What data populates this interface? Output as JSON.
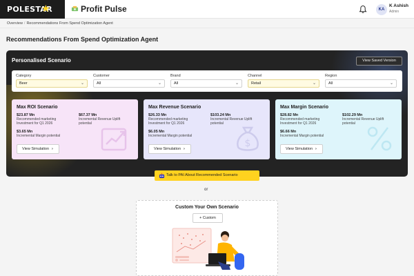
{
  "header": {
    "brand": "POLESTAR",
    "product": "Profit Pulse",
    "user": {
      "initials": "KA",
      "name": "K Ashish",
      "role": "Admin"
    },
    "icons": [
      "bell-icon",
      "star-icon",
      "money-icon"
    ]
  },
  "breadcrumb": {
    "root": "Overview",
    "separator": "/",
    "current": "Recommendations From Spend Optimization Agent"
  },
  "page_title": "Recommendations From Spend Optimization Agent",
  "scenario_panel": {
    "title": "Personalised Scenario",
    "saved_button": "View Saved Version",
    "filters": [
      {
        "label": "Category",
        "value": "Beer"
      },
      {
        "label": "Customer",
        "value": "All"
      },
      {
        "label": "Brand",
        "value": "All"
      },
      {
        "label": "Channel",
        "value": "Retail"
      },
      {
        "label": "Region",
        "value": "All"
      }
    ],
    "cards": [
      {
        "title": "Max ROI Scenario",
        "investment_value": "$23.87 Mn",
        "investment_label": "Recommended marketing Investment for Q1 2026",
        "uplift_value": "$67.37 Mn",
        "uplift_label": "Incremental Revenue Uplift potential",
        "margin_value": "$3.65 Mn",
        "margin_label": "Incremental Margin potential",
        "button": "View Simulation",
        "icon": "trend-up-icon"
      },
      {
        "title": "Max Revenue Scenario",
        "investment_value": "$26.33 Mn",
        "investment_label": "Recommended marketing Investment for Q1 2026",
        "uplift_value": "$103.24 Mn",
        "uplift_label": "Incremental Revenue Uplift potential",
        "margin_value": "$6.05 Mn",
        "margin_label": "Incremental Margin potential",
        "button": "View Simulation",
        "icon": "money-bag-icon"
      },
      {
        "title": "Max Margin Scenario",
        "investment_value": "$28.82 Mn",
        "investment_label": "Recommended marketing Investment for Q1 2026",
        "uplift_value": "$102.29 Mn",
        "uplift_label": "Incremental Revenue Uplift potential",
        "margin_value": "$6.66 Mn",
        "margin_label": "Incremental Margin potential",
        "button": "View Simulation",
        "icon": "percent-icon"
      }
    ]
  },
  "cta": {
    "label": "Talk to PAI About Recommended Scenario"
  },
  "or_text": "or",
  "custom": {
    "title": "Custom Your Own Scenario",
    "button": "+ Custom"
  },
  "colors": {
    "accent": "#ffd21f",
    "panel": "#232323",
    "roi_card": "#f7e4f8",
    "revenue_card": "#e7e6fb",
    "margin_card": "#def5fb"
  }
}
